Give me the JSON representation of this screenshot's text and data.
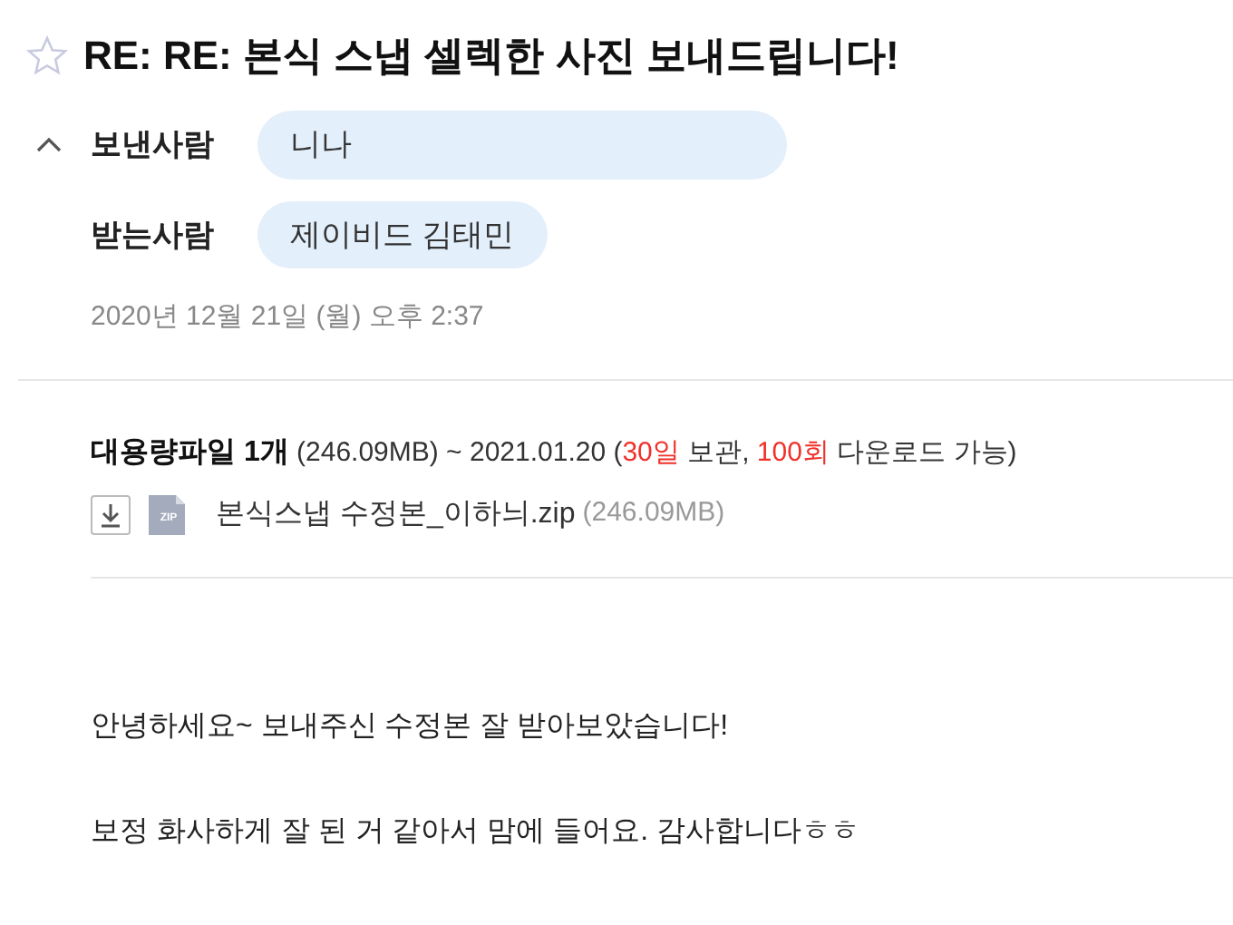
{
  "subject": {
    "title": "RE: RE: 본식 스냅 셀렉한 사진 보내드립니다!",
    "starred": false
  },
  "header": {
    "expanded": true,
    "sender": {
      "label": "보낸사람",
      "name": "니나"
    },
    "recipient": {
      "label": "받는사람",
      "name": "제이비드 김태민"
    },
    "date": "2020년 12월 21일 (월) 오후 2:37"
  },
  "attachments": {
    "summary": [
      {
        "kind": "bold",
        "text": "대용량파일 1개"
      },
      {
        "kind": "plain",
        "text": "(246.09MB) ~ 2021.01.20 ("
      },
      {
        "kind": "red",
        "text": "30일"
      },
      {
        "kind": "plain",
        "text": "보관,"
      },
      {
        "kind": "red",
        "text": "100회"
      },
      {
        "kind": "plain",
        "text": "다운로드 가능)"
      }
    ],
    "files": [
      {
        "name": "본식스냅 수정본_이하늬.zip",
        "size": "(246.09MB)",
        "type": "ZIP"
      }
    ]
  },
  "body": [
    "안녕하세요~ 보내주신 수정본 잘 받아보았습니다!",
    "보정 화사하게 잘 된 거 같아서 맘에 들어요. 감사합니다ㅎㅎ"
  ]
}
